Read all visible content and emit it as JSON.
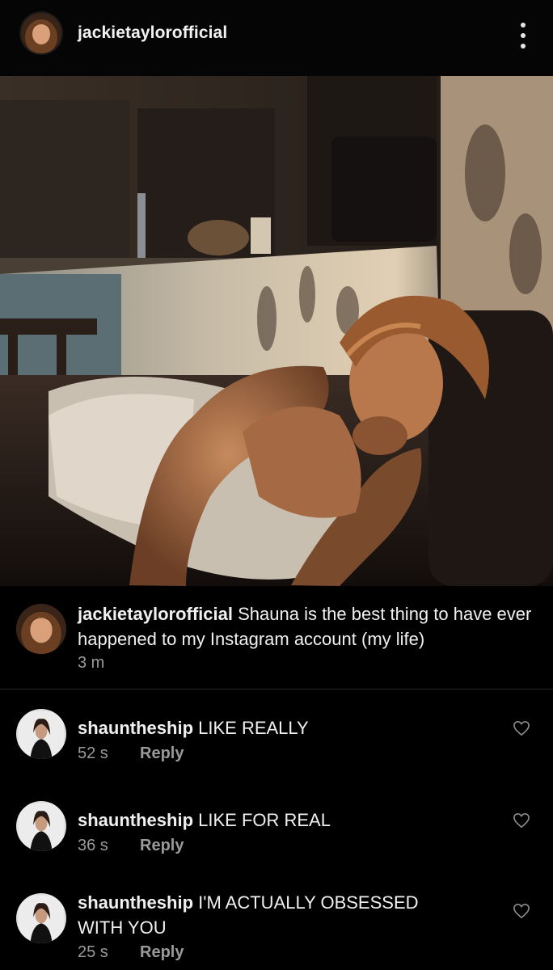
{
  "header": {
    "username": "jackietaylorofficial",
    "avatar_icon": "profile-avatar",
    "more_icon": "more-vertical-icon"
  },
  "post": {
    "image_description_icon": "post-photo"
  },
  "caption": {
    "username": "jackietaylorofficial",
    "text": "Shauna is the best thing to have ever happened to my Instagram account (my life)",
    "time": "3 m"
  },
  "comments": [
    {
      "username": "shauntheship",
      "text": "LIKE REALLY",
      "time": "52 s",
      "reply": "Reply"
    },
    {
      "username": "shauntheship",
      "text": "LIKE FOR REAL",
      "time": "36 s",
      "reply": "Reply"
    },
    {
      "username": "shauntheship",
      "text": "I'M ACTUALLY OBSESSED WITH YOU",
      "time": "25 s",
      "reply": "Reply"
    }
  ],
  "colors": {
    "background": "#000000",
    "secondary_text": "#9a9a9a",
    "primary_text": "#f0f0f0"
  }
}
